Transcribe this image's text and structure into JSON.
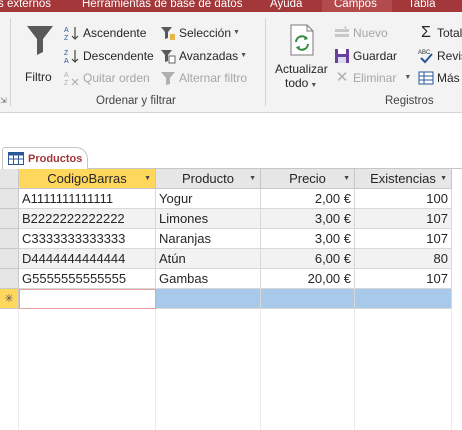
{
  "ribbon_tabs": [
    "s externos",
    "Herramientas de base de datos",
    "Ayuda",
    "Campos",
    "Tabla"
  ],
  "sort_filter": {
    "filter_label": "Filtro",
    "asc_label": "Ascendente",
    "desc_label": "Descendente",
    "remove_sort_label": "Quitar orden",
    "selection_label": "Selección",
    "advanced_label": "Avanzadas",
    "toggle_filter_label": "Alternar filtro",
    "group_label": "Ordenar y filtrar"
  },
  "records": {
    "refresh_label_1": "Actualizar",
    "refresh_label_2": "todo",
    "new_label": "Nuevo",
    "save_label": "Guardar",
    "delete_label": "Eliminar",
    "totals_label": "Total",
    "spelling_label": "Revis",
    "more_label": "Más",
    "group_label": "Registros"
  },
  "document_tab": {
    "label": "Productos"
  },
  "table": {
    "columns": [
      "CodigoBarras",
      "Producto",
      "Precio",
      "Existencias"
    ],
    "rows": [
      [
        "A1111111111111",
        "Yogur",
        "2,00 €",
        "100"
      ],
      [
        "B2222222222222",
        "Limones",
        "3,00 €",
        "107"
      ],
      [
        "C3333333333333",
        "Naranjas",
        "3,00 €",
        "107"
      ],
      [
        "D4444444444444",
        "Atún",
        "6,00 €",
        "80"
      ],
      [
        "G5555555555555",
        "Gambas",
        "20,00 €",
        "107"
      ]
    ],
    "new_row_marker": "✳"
  },
  "colors": {
    "access_red": "#a4373a",
    "header_selected": "#ffd75d",
    "new_row": "#a9c9ea"
  }
}
